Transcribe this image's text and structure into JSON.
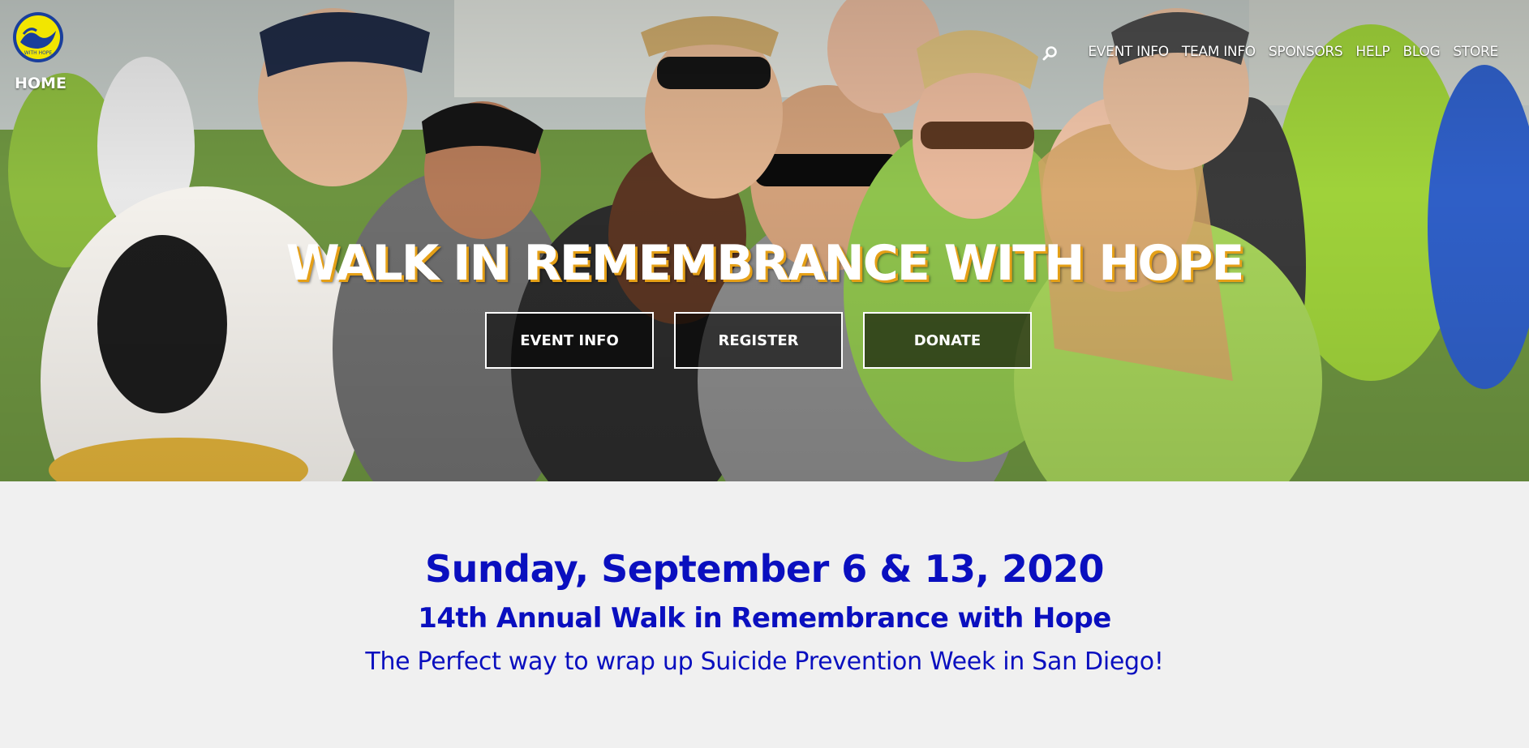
{
  "nav": {
    "home": "HOME",
    "links": [
      "EVENT INFO",
      "TEAM INFO",
      "SPONSORS",
      "HELP",
      "BLOG",
      "STORE"
    ],
    "search_icon": "search-icon"
  },
  "logo": {
    "text": "WITH HOPE",
    "icon": "wave-logo-icon",
    "colors": {
      "ring": "#1a3f9c",
      "fill": "#f2e600"
    }
  },
  "hero": {
    "title": "WALK IN REMEMBRANCE WITH HOPE",
    "buttons": [
      "EVENT INFO",
      "REGISTER",
      "DONATE"
    ],
    "colors": {
      "title_shadow": "#e5a017",
      "button_bg": "rgba(0,0,0,0.6)"
    }
  },
  "content": {
    "date": "Sunday, September 6 & 13, 2020",
    "subtitle": "14th Annual Walk in Remembrance with Hope",
    "tagline": "The Perfect way to wrap up Suicide Prevention Week in San Diego!",
    "colors": {
      "text": "#0a0fbf",
      "background": "#f0f0f0"
    }
  }
}
